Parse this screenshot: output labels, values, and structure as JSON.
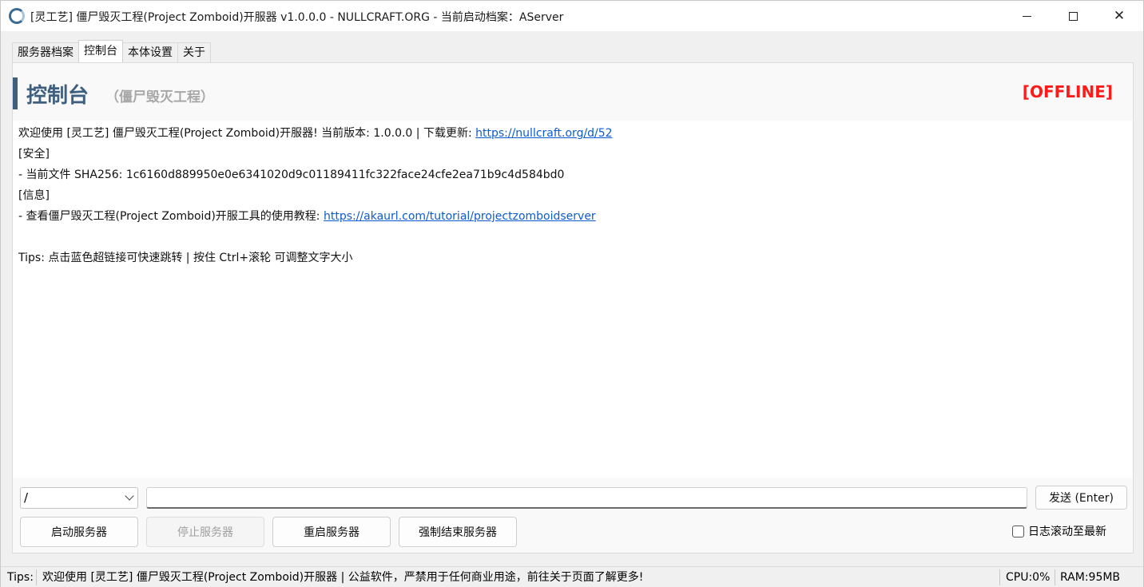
{
  "window": {
    "title": "[灵工艺] 僵尸毁灭工程(Project Zomboid)开服器 v1.0.0.0 - NULLCRAFT.ORG - 当前启动档案：AServer",
    "icon": "app-logo-icon",
    "controls": {
      "minimize": "minimize-icon",
      "maximize": "maximize-icon",
      "close": "✕"
    }
  },
  "tabs": [
    {
      "label": "服务器档案",
      "active": false
    },
    {
      "label": "控制台",
      "active": true
    },
    {
      "label": "本体设置",
      "active": false
    },
    {
      "label": "关于",
      "active": false
    }
  ],
  "header": {
    "title": "控制台",
    "subtitle": "（僵尸毁灭工程）",
    "status": "[OFFLINE]",
    "accent_color": "#3f5f7f",
    "status_color": "#ff1a1a"
  },
  "log": {
    "line1_text": "欢迎使用 [灵工艺] 僵尸毁灭工程(Project Zomboid)开服器! 当前版本: 1.0.0.0 | 下载更新: ",
    "line1_link": "https://nullcraft.org/d/52",
    "line2": "[安全]",
    "line3": "- 当前文件 SHA256: 1c6160d889950e0e6341020d9c01189411fc322face24cfe2ea71b9c4d584bd0",
    "line4": "[信息]",
    "line5_text": "- 查看僵尸毁灭工程(Project Zomboid)开服工具的使用教程: ",
    "line5_link": "https://akaurl.com/tutorial/projectzomboidserver",
    "line6": "",
    "line7": "Tips: 点击蓝色超链接可快速跳转 | 按住 Ctrl+滚轮 可调整文字大小"
  },
  "command": {
    "prefix_selected": "/",
    "input_value": "",
    "send_label": "发送 (Enter)"
  },
  "actions": {
    "start": "启动服务器",
    "stop": "停止服务器",
    "restart": "重启服务器",
    "kill": "强制结束服务器",
    "autoscroll_label": "日志滚动至最新",
    "autoscroll_checked": false
  },
  "statusbar": {
    "label": "Tips:",
    "message": "欢迎使用 [灵工艺] 僵尸毁灭工程(Project Zomboid)开服器 | 公益软件，严禁用于任何商业用途，前往关于页面了解更多!",
    "cpu": "CPU:0%",
    "ram": "RAM:95MB"
  }
}
